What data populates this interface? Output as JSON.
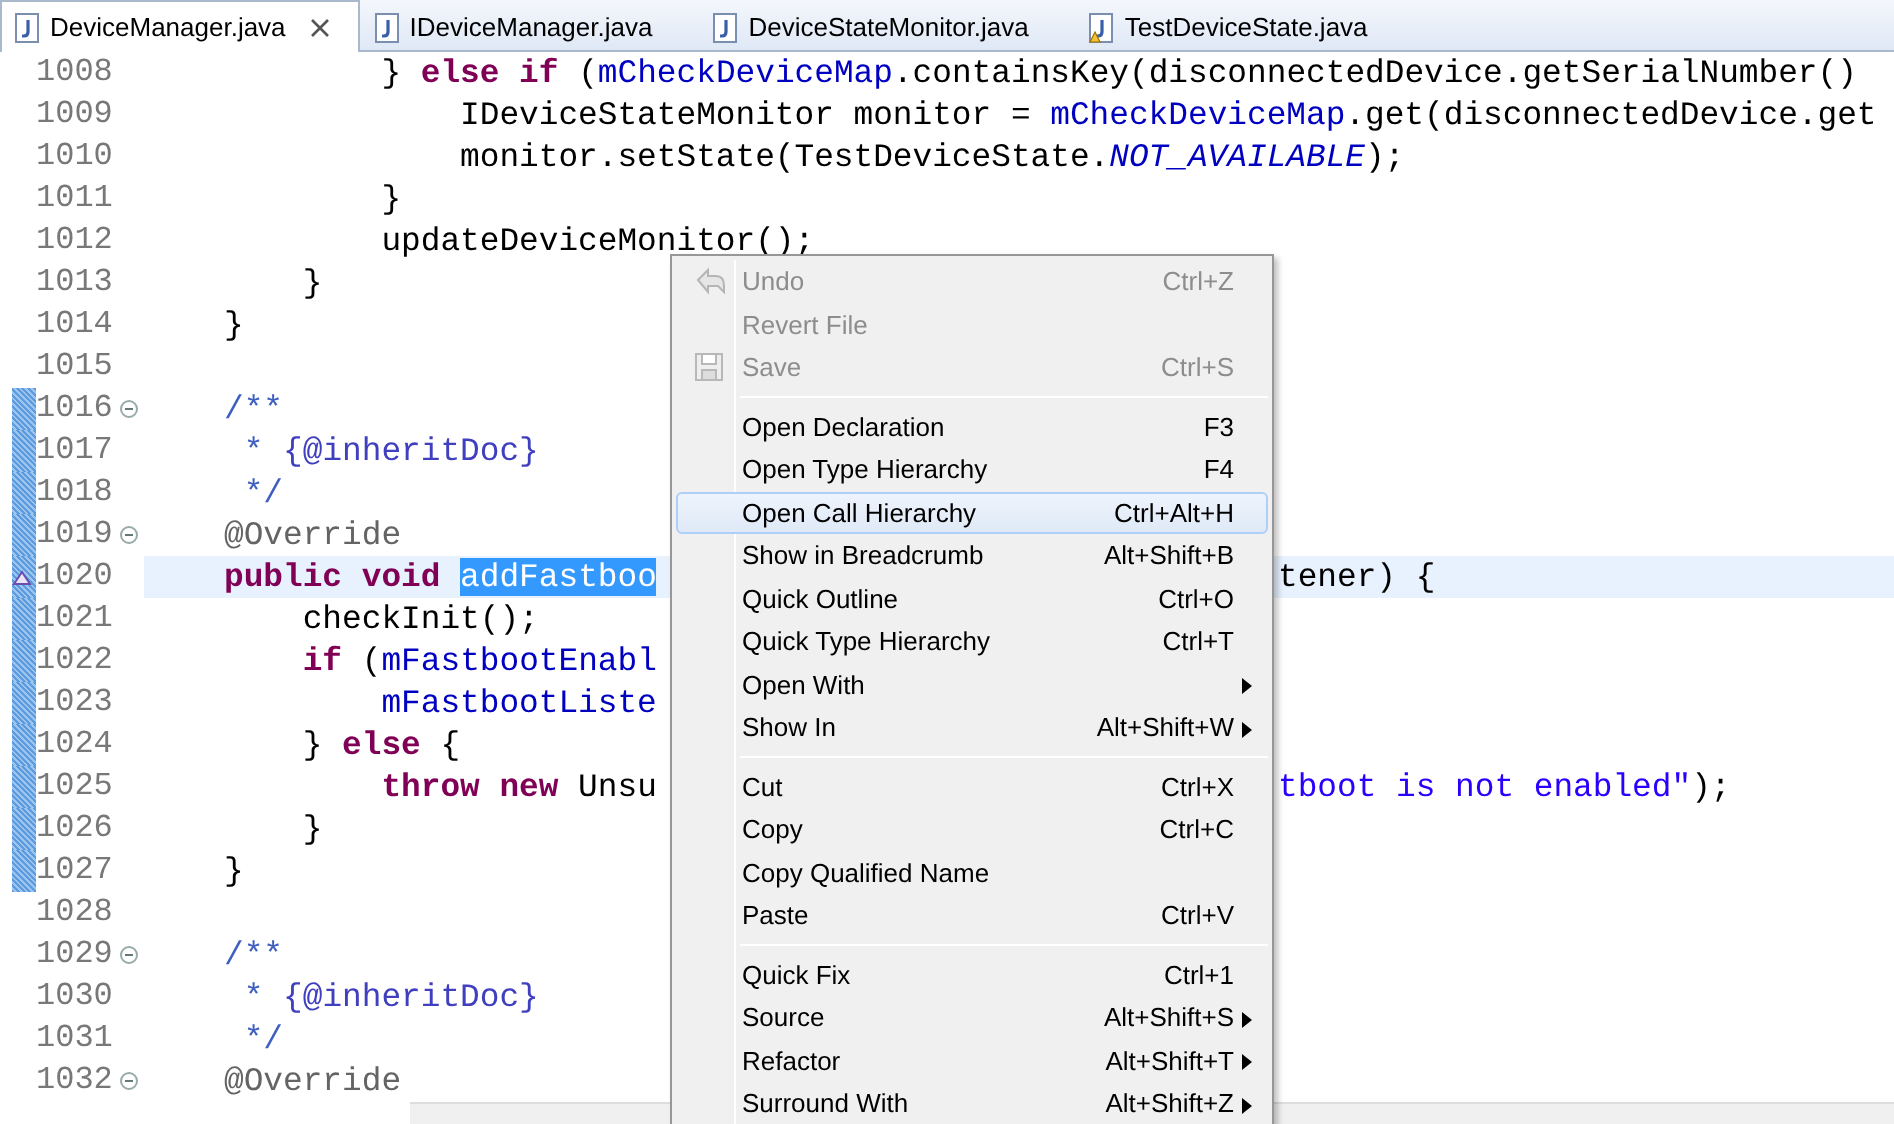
{
  "tabs": [
    {
      "label": "DeviceManager.java",
      "selected": true,
      "closable": true,
      "warning": false
    },
    {
      "label": "IDeviceManager.java",
      "selected": false,
      "closable": false,
      "warning": false
    },
    {
      "label": "DeviceStateMonitor.java",
      "selected": false,
      "closable": false,
      "warning": false
    },
    {
      "label": "TestDeviceState.java",
      "selected": false,
      "closable": false,
      "warning": true
    }
  ],
  "editor": {
    "lines": [
      {
        "number": "1008",
        "fold": false,
        "range": false,
        "current": false,
        "tokens": [
          {
            "kind": "plain",
            "text": "        } "
          },
          {
            "kind": "keyword",
            "text": "else if"
          },
          {
            "kind": "plain",
            "text": " ("
          },
          {
            "kind": "field",
            "text": "mCheckDeviceMap"
          },
          {
            "kind": "plain",
            "text": ".containsKey(disconnectedDevice.getSerialNumber()"
          }
        ]
      },
      {
        "number": "1009",
        "fold": false,
        "range": false,
        "current": false,
        "tokens": [
          {
            "kind": "plain",
            "text": "            IDeviceStateMonitor monitor = "
          },
          {
            "kind": "field",
            "text": "mCheckDeviceMap"
          },
          {
            "kind": "plain",
            "text": ".get(disconnectedDevice.get"
          }
        ]
      },
      {
        "number": "1010",
        "fold": false,
        "range": false,
        "current": false,
        "tokens": [
          {
            "kind": "plain",
            "text": "            monitor.setState(TestDeviceState."
          },
          {
            "kind": "static",
            "text": "NOT_AVAILABLE"
          },
          {
            "kind": "plain",
            "text": ");"
          }
        ]
      },
      {
        "number": "1011",
        "fold": false,
        "range": false,
        "current": false,
        "tokens": [
          {
            "kind": "plain",
            "text": "        }"
          }
        ]
      },
      {
        "number": "1012",
        "fold": false,
        "range": false,
        "current": false,
        "tokens": [
          {
            "kind": "plain",
            "text": "        updateDeviceMonitor();"
          }
        ]
      },
      {
        "number": "1013",
        "fold": false,
        "range": false,
        "current": false,
        "tokens": [
          {
            "kind": "plain",
            "text": "    }"
          }
        ]
      },
      {
        "number": "1014",
        "fold": false,
        "range": false,
        "current": false,
        "tokens": [
          {
            "kind": "plain",
            "text": "}"
          }
        ]
      },
      {
        "number": "1015",
        "fold": false,
        "range": false,
        "current": false
      },
      {
        "number": "1016",
        "fold": true,
        "range": true,
        "current": false,
        "tokens": [
          {
            "kind": "javadoc",
            "text": "/**"
          }
        ]
      },
      {
        "number": "1017",
        "fold": false,
        "range": true,
        "current": false,
        "tokens": [
          {
            "kind": "javadoc",
            "text": " * "
          },
          {
            "kind": "doctag",
            "text": "{@inheritDoc}"
          }
        ]
      },
      {
        "number": "1018",
        "fold": false,
        "range": true,
        "current": false,
        "tokens": [
          {
            "kind": "javadoc",
            "text": " */"
          }
        ]
      },
      {
        "number": "1019",
        "fold": true,
        "range": true,
        "current": false,
        "tokens": [
          {
            "kind": "annotation",
            "text": "@Override"
          }
        ]
      },
      {
        "number": "1020",
        "fold": false,
        "range": true,
        "current": true,
        "tokens": [
          {
            "kind": "keyword",
            "text": "public void "
          },
          {
            "kind": "selection",
            "text": "addFastboo"
          }
        ],
        "right": [
          {
            "kind": "plain",
            "text": "tener) {"
          }
        ]
      },
      {
        "number": "1021",
        "fold": false,
        "range": true,
        "current": false,
        "tokens": [
          {
            "kind": "plain",
            "text": "    checkInit();"
          }
        ]
      },
      {
        "number": "1022",
        "fold": false,
        "range": true,
        "current": false,
        "tokens": [
          {
            "kind": "keyword",
            "text": "    if"
          },
          {
            "kind": "plain",
            "text": " ("
          },
          {
            "kind": "field",
            "text": "mFastbootEnabl"
          }
        ]
      },
      {
        "number": "1023",
        "fold": false,
        "range": true,
        "current": false,
        "tokens": [
          {
            "kind": "field",
            "text": "        mFastbootListe"
          }
        ]
      },
      {
        "number": "1024",
        "fold": false,
        "range": true,
        "current": false,
        "tokens": [
          {
            "kind": "plain",
            "text": "    } "
          },
          {
            "kind": "keyword",
            "text": "else"
          },
          {
            "kind": "plain",
            "text": " {"
          }
        ]
      },
      {
        "number": "1025",
        "fold": false,
        "range": true,
        "current": false,
        "tokens": [
          {
            "kind": "keyword",
            "text": "        throw new"
          },
          {
            "kind": "plain",
            "text": " Unsu"
          }
        ],
        "right": [
          {
            "kind": "string",
            "text": "tboot is not enabled\""
          },
          {
            "kind": "plain",
            "text": ");"
          }
        ]
      },
      {
        "number": "1026",
        "fold": false,
        "range": true,
        "current": false,
        "tokens": [
          {
            "kind": "plain",
            "text": "    }"
          }
        ]
      },
      {
        "number": "1027",
        "fold": false,
        "range": true,
        "current": false,
        "tokens": [
          {
            "kind": "plain",
            "text": "}"
          }
        ]
      },
      {
        "number": "1028",
        "fold": false,
        "range": false,
        "current": false
      },
      {
        "number": "1029",
        "fold": true,
        "range": false,
        "current": false,
        "tokens": [
          {
            "kind": "javadoc",
            "text": "/**"
          }
        ]
      },
      {
        "number": "1030",
        "fold": false,
        "range": false,
        "current": false,
        "tokens": [
          {
            "kind": "javadoc",
            "text": " * "
          },
          {
            "kind": "doctag",
            "text": "{@inheritDoc}"
          }
        ]
      },
      {
        "number": "1031",
        "fold": false,
        "range": false,
        "current": false,
        "tokens": [
          {
            "kind": "javadoc",
            "text": " */"
          }
        ]
      },
      {
        "number": "1032",
        "fold": true,
        "range": false,
        "current": false,
        "tokens": [
          {
            "kind": "annotation",
            "text": "@Override"
          }
        ]
      }
    ]
  },
  "context_menu": {
    "items": [
      {
        "kind": "undo_item",
        "label": "Undo",
        "shortcut": "Ctrl+Z",
        "disabled": true,
        "selected": false,
        "submenu": false
      },
      {
        "kind": "item",
        "label": "Revert File",
        "disabled": true,
        "selected": false,
        "submenu": false
      },
      {
        "kind": "save_item",
        "label": "Save",
        "shortcut": "Ctrl+S",
        "disabled": true,
        "selected": false,
        "submenu": false
      },
      {
        "kind": "separator"
      },
      {
        "kind": "item",
        "label": "Open Declaration",
        "shortcut": "F3",
        "disabled": false,
        "selected": false,
        "submenu": false
      },
      {
        "kind": "item",
        "label": "Open Type Hierarchy",
        "shortcut": "F4",
        "disabled": false,
        "selected": false,
        "submenu": false
      },
      {
        "kind": "item",
        "label": "Open Call Hierarchy",
        "shortcut": "Ctrl+Alt+H",
        "disabled": false,
        "selected": true,
        "submenu": false
      },
      {
        "kind": "item",
        "label": "Show in Breadcrumb",
        "shortcut": "Alt+Shift+B",
        "disabled": false,
        "selected": false,
        "submenu": false
      },
      {
        "kind": "item",
        "label": "Quick Outline",
        "shortcut": "Ctrl+O",
        "disabled": false,
        "selected": false,
        "submenu": false
      },
      {
        "kind": "item",
        "label": "Quick Type Hierarchy",
        "shortcut": "Ctrl+T",
        "disabled": false,
        "selected": false,
        "submenu": false
      },
      {
        "kind": "item",
        "label": "Open With",
        "disabled": false,
        "selected": false,
        "submenu": true
      },
      {
        "kind": "item",
        "label": "Show In",
        "shortcut": "Alt+Shift+W",
        "disabled": false,
        "selected": false,
        "submenu": true
      },
      {
        "kind": "separator"
      },
      {
        "kind": "item",
        "label": "Cut",
        "shortcut": "Ctrl+X",
        "disabled": false,
        "selected": false,
        "submenu": false
      },
      {
        "kind": "item",
        "label": "Copy",
        "shortcut": "Ctrl+C",
        "disabled": false,
        "selected": false,
        "submenu": false
      },
      {
        "kind": "item",
        "label": "Copy Qualified Name",
        "disabled": false,
        "selected": false,
        "submenu": false
      },
      {
        "kind": "item",
        "label": "Paste",
        "shortcut": "Ctrl+V",
        "disabled": false,
        "selected": false,
        "submenu": false
      },
      {
        "kind": "separator"
      },
      {
        "kind": "item",
        "label": "Quick Fix",
        "shortcut": "Ctrl+1",
        "disabled": false,
        "selected": false,
        "submenu": false
      },
      {
        "kind": "item",
        "label": "Source",
        "shortcut": "Alt+Shift+S",
        "disabled": false,
        "selected": false,
        "submenu": true
      },
      {
        "kind": "item",
        "label": "Refactor",
        "shortcut": "Alt+Shift+T",
        "disabled": false,
        "selected": false,
        "submenu": true
      },
      {
        "kind": "item",
        "label": "Surround With",
        "shortcut": "Alt+Shift+Z",
        "disabled": false,
        "selected": false,
        "submenu": true
      }
    ]
  }
}
